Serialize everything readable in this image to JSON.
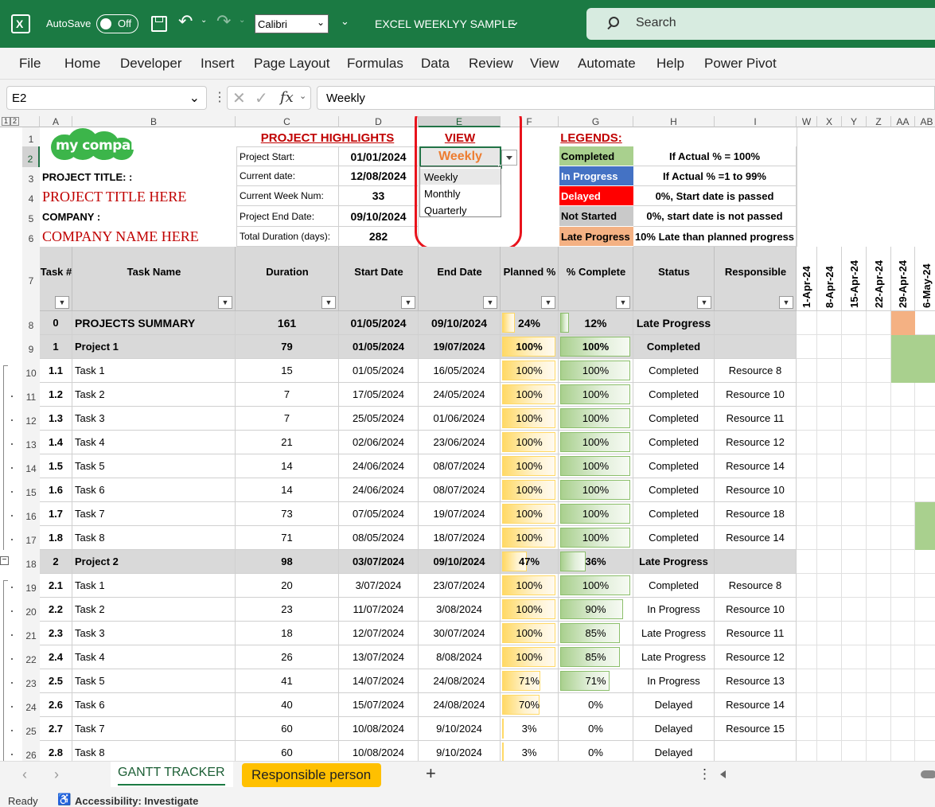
{
  "titlebar": {
    "autosave_label": "AutoSave",
    "autosave_state": "Off",
    "font_name": "Calibri",
    "doc_title": "EXCEL WEEKLYY SAMPLE",
    "search_placeholder": "Search"
  },
  "ribbon": {
    "tabs": [
      "File",
      "Home",
      "Developer",
      "Insert",
      "Page Layout",
      "Formulas",
      "Data",
      "Review",
      "View",
      "Automate",
      "Help",
      "Power Pivot"
    ]
  },
  "formulabar": {
    "name_box": "E2",
    "fx": "fx",
    "content": "Weekly"
  },
  "columns": [
    "A",
    "B",
    "C",
    "D",
    "E",
    "F",
    "G",
    "H",
    "I",
    "W",
    "X",
    "Y",
    "Z",
    "AA",
    "AB"
  ],
  "outline_levels": [
    "1",
    "2"
  ],
  "header": {
    "logo_text": "my company",
    "project_title_label": "PROJECT TITLE: :",
    "project_title_value": "PROJECT TITLE HERE",
    "company_label": "COMPANY :",
    "company_value": "COMPANY NAME HERE",
    "highlights_title": "PROJECT HIGHLIGHTS",
    "highlights": [
      {
        "label": "Project Start:",
        "value": "01/01/2024"
      },
      {
        "label": "Current date:",
        "value": "12/08/2024"
      },
      {
        "label": "Current Week Num:",
        "value": "33"
      },
      {
        "label": "Project End Date:",
        "value": "09/10/2024"
      },
      {
        "label": "Total Duration (days):",
        "value": "282"
      }
    ],
    "view_title": "VIEW",
    "view_value": "Weekly",
    "view_options": [
      "Weekly",
      "Monthly",
      "Quarterly"
    ],
    "legends_title": "LEGENDS:",
    "legends": [
      {
        "label": "Completed",
        "desc": "If Actual % = 100%",
        "color": "#a9d08e",
        "text_color": "#000000"
      },
      {
        "label": "In Progress",
        "desc": "If Actual % =1 to 99%",
        "color": "#4472c4",
        "text_color": "#ffffff"
      },
      {
        "label": "Delayed",
        "desc": "0%, Start date is passed",
        "color": "#ff0000",
        "text_color": "#ffffff"
      },
      {
        "label": "Not Started",
        "desc": "0%, start date is not passed",
        "color": "#c9c9c9",
        "text_color": "#000000"
      },
      {
        "label": "Late Progress",
        "desc": "10% Late than planned progress",
        "color": "#f4b183",
        "text_color": "#000000"
      }
    ]
  },
  "table_headers": [
    "Task #",
    "Task Name",
    "Duration",
    "Start Date",
    "End Date",
    "Planned %",
    "% Complete",
    "Status",
    "Responsible"
  ],
  "week_headers": [
    "1-Apr-24",
    "8-Apr-24",
    "15-Apr-24",
    "22-Apr-24",
    "29-Apr-24",
    "6-May-24"
  ],
  "row_numbers": [
    "1",
    "2",
    "3",
    "4",
    "5",
    "6",
    "7",
    "8",
    "9",
    "10",
    "11",
    "12",
    "13",
    "14",
    "15",
    "16",
    "17",
    "18",
    "19",
    "20",
    "21",
    "22",
    "23",
    "24",
    "25",
    "26"
  ],
  "rows": [
    {
      "id": "0",
      "name": "PROJECTS SUMMARY",
      "duration": "161",
      "start": "01/05/2024",
      "end": "09/10/2024",
      "planned": "24%",
      "planned_pct": 24,
      "complete": "12%",
      "complete_pct": 12,
      "status": "Late Progress",
      "resp": "",
      "type": "summary"
    },
    {
      "id": "1",
      "name": "Project 1",
      "duration": "79",
      "start": "01/05/2024",
      "end": "19/07/2024",
      "planned": "100%",
      "planned_pct": 100,
      "complete": "100%",
      "complete_pct": 100,
      "status": "Completed",
      "resp": "",
      "type": "project"
    },
    {
      "id": "1.1",
      "name": "Task 1",
      "duration": "15",
      "start": "01/05/2024",
      "end": "16/05/2024",
      "planned": "100%",
      "planned_pct": 100,
      "complete": "100%",
      "complete_pct": 100,
      "status": "Completed",
      "resp": "Resource 8",
      "type": "task"
    },
    {
      "id": "1.2",
      "name": "Task 2",
      "duration": "7",
      "start": "17/05/2024",
      "end": "24/05/2024",
      "planned": "100%",
      "planned_pct": 100,
      "complete": "100%",
      "complete_pct": 100,
      "status": "Completed",
      "resp": "Resource 10",
      "type": "task"
    },
    {
      "id": "1.3",
      "name": "Task 3",
      "duration": "7",
      "start": "25/05/2024",
      "end": "01/06/2024",
      "planned": "100%",
      "planned_pct": 100,
      "complete": "100%",
      "complete_pct": 100,
      "status": "Completed",
      "resp": "Resource 11",
      "type": "task"
    },
    {
      "id": "1.4",
      "name": "Task 4",
      "duration": "21",
      "start": "02/06/2024",
      "end": "23/06/2024",
      "planned": "100%",
      "planned_pct": 100,
      "complete": "100%",
      "complete_pct": 100,
      "status": "Completed",
      "resp": "Resource 12",
      "type": "task"
    },
    {
      "id": "1.5",
      "name": "Task 5",
      "duration": "14",
      "start": "24/06/2024",
      "end": "08/07/2024",
      "planned": "100%",
      "planned_pct": 100,
      "complete": "100%",
      "complete_pct": 100,
      "status": "Completed",
      "resp": "Resource 14",
      "type": "task"
    },
    {
      "id": "1.6",
      "name": "Task 6",
      "duration": "14",
      "start": "24/06/2024",
      "end": "08/07/2024",
      "planned": "100%",
      "planned_pct": 100,
      "complete": "100%",
      "complete_pct": 100,
      "status": "Completed",
      "resp": "Resource 10",
      "type": "task"
    },
    {
      "id": "1.7",
      "name": "Task 7",
      "duration": "73",
      "start": "07/05/2024",
      "end": "19/07/2024",
      "planned": "100%",
      "planned_pct": 100,
      "complete": "100%",
      "complete_pct": 100,
      "status": "Completed",
      "resp": "Resource 18",
      "type": "task"
    },
    {
      "id": "1.8",
      "name": "Task 8",
      "duration": "71",
      "start": "08/05/2024",
      "end": "18/07/2024",
      "planned": "100%",
      "planned_pct": 100,
      "complete": "100%",
      "complete_pct": 100,
      "status": "Completed",
      "resp": "Resource 14",
      "type": "task"
    },
    {
      "id": "2",
      "name": "Project 2",
      "duration": "98",
      "start": "03/07/2024",
      "end": "09/10/2024",
      "planned": "47%",
      "planned_pct": 47,
      "complete": "36%",
      "complete_pct": 36,
      "status": "Late Progress",
      "resp": "",
      "type": "project"
    },
    {
      "id": "2.1",
      "name": "Task 1",
      "duration": "20",
      "start": "3/07/2024",
      "end": "23/07/2024",
      "planned": "100%",
      "planned_pct": 100,
      "complete": "100%",
      "complete_pct": 100,
      "status": "Completed",
      "resp": "Resource 8",
      "type": "task"
    },
    {
      "id": "2.2",
      "name": "Task 2",
      "duration": "23",
      "start": "11/07/2024",
      "end": "3/08/2024",
      "planned": "100%",
      "planned_pct": 100,
      "complete": "90%",
      "complete_pct": 90,
      "status": "In Progress",
      "resp": "Resource 10",
      "type": "task"
    },
    {
      "id": "2.3",
      "name": "Task 3",
      "duration": "18",
      "start": "12/07/2024",
      "end": "30/07/2024",
      "planned": "100%",
      "planned_pct": 100,
      "complete": "85%",
      "complete_pct": 85,
      "status": "Late Progress",
      "resp": "Resource 11",
      "type": "task"
    },
    {
      "id": "2.4",
      "name": "Task 4",
      "duration": "26",
      "start": "13/07/2024",
      "end": "8/08/2024",
      "planned": "100%",
      "planned_pct": 100,
      "complete": "85%",
      "complete_pct": 85,
      "status": "Late Progress",
      "resp": "Resource 12",
      "type": "task"
    },
    {
      "id": "2.5",
      "name": "Task 5",
      "duration": "41",
      "start": "14/07/2024",
      "end": "24/08/2024",
      "planned": "71%",
      "planned_pct": 71,
      "complete": "71%",
      "complete_pct": 71,
      "status": "In Progress",
      "resp": "Resource 13",
      "type": "task"
    },
    {
      "id": "2.6",
      "name": "Task 6",
      "duration": "40",
      "start": "15/07/2024",
      "end": "24/08/2024",
      "planned": "70%",
      "planned_pct": 70,
      "complete": "0%",
      "complete_pct": 0,
      "status": "Delayed",
      "resp": "Resource 14",
      "type": "task"
    },
    {
      "id": "2.7",
      "name": "Task 7",
      "duration": "60",
      "start": "10/08/2024",
      "end": "9/10/2024",
      "planned": "3%",
      "planned_pct": 3,
      "complete": "0%",
      "complete_pct": 0,
      "status": "Delayed",
      "resp": "Resource 15",
      "type": "task"
    },
    {
      "id": "2.8",
      "name": "Task 8",
      "duration": "60",
      "start": "10/08/2024",
      "end": "9/10/2024",
      "planned": "3%",
      "planned_pct": 3,
      "complete": "0%",
      "complete_pct": 0,
      "status": "Delayed",
      "resp": "",
      "type": "task"
    }
  ],
  "gantt_fills": [
    {
      "row": 0,
      "col": 4,
      "color": "#f4b183"
    },
    {
      "row": 1,
      "col": 4,
      "color": "#a9d08e"
    },
    {
      "row": 1,
      "col": 5,
      "color": "#a9d08e"
    },
    {
      "row": 2,
      "col": 4,
      "color": "#a9d08e"
    },
    {
      "row": 2,
      "col": 5,
      "color": "#a9d08e"
    },
    {
      "row": 8,
      "col": 5,
      "color": "#a9d08e"
    },
    {
      "row": 9,
      "col": 5,
      "color": "#a9d08e"
    }
  ],
  "sheet_tabs": [
    {
      "label": "GANTT TRACKER",
      "active": true
    },
    {
      "label": "Responsible person",
      "active": false
    }
  ],
  "status": {
    "ready": "Ready",
    "accessibility": "Accessibility: Investigate"
  }
}
